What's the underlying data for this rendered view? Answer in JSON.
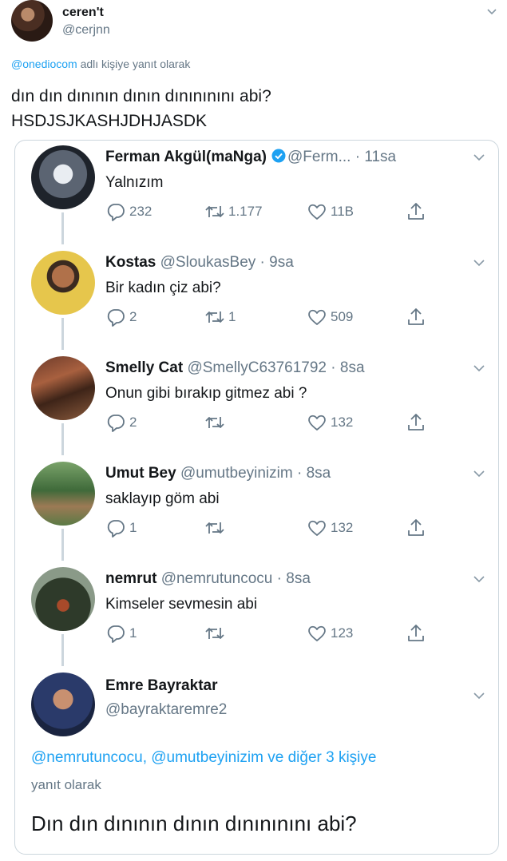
{
  "outer": {
    "name": "ceren't",
    "handle": "@cerjnn",
    "reply_mention": "@onediocom",
    "reply_suffix": " adlı kişiye yanıt olarak",
    "text_line1": "dın dın dınının dının dınınınını abi?",
    "text_line2": "HSDJSJKASHJDHJASDK"
  },
  "thread": [
    {
      "name": "Ferman Akgül(maNga)",
      "verified": true,
      "handle": "@Ferm...",
      "time": " · 11sa",
      "text": "Yalnızım",
      "replies": "232",
      "retweets": "1.177",
      "likes": "11B"
    },
    {
      "name": "Kostas",
      "handle": "@SloukasBey",
      "time": " · 9sa",
      "text": "Bir kadın çiz abi?",
      "replies": "2",
      "retweets": "1",
      "likes": "509"
    },
    {
      "name": "Smelly Cat",
      "handle": "@SmellyC63761792",
      "time": " · 8sa",
      "text": "Onun gibi bırakıp gitmez abi ?",
      "replies": "2",
      "retweets": "",
      "likes": "132"
    },
    {
      "name": "Umut Bey",
      "handle": "@umutbeyinizim",
      "time": " · 8sa",
      "text": "saklayıp göm abi",
      "replies": "1",
      "retweets": "",
      "likes": "132"
    },
    {
      "name": "nemrut",
      "handle": "@nemrutuncocu",
      "time": " · 8sa",
      "text": "Kimseler sevmesin abi",
      "replies": "1",
      "retweets": "",
      "likes": "123"
    }
  ],
  "last": {
    "name": "Emre Bayraktar",
    "handle": "@bayraktaremre2",
    "reply_context": "@nemrutuncocu, @umutbeyinizim ve diğer 3 kişiye",
    "reply_context2": "yanıt olarak",
    "text": "Dın dın dınının dının dınınınını abi?"
  },
  "colors": {
    "accent": "#1da1f2",
    "secondary_text": "#657786",
    "border": "#ccd6dd"
  }
}
